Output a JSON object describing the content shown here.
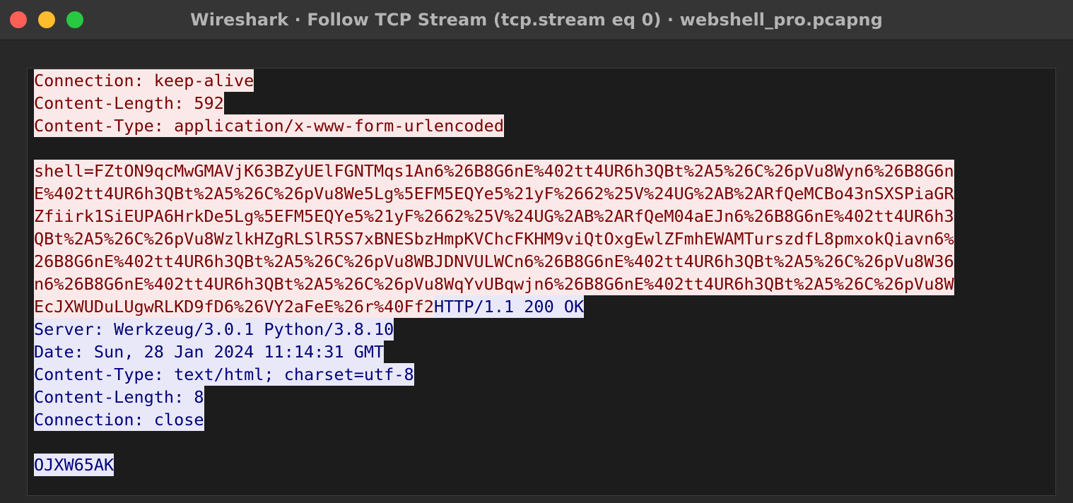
{
  "window": {
    "title": "Wireshark · Follow TCP Stream (tcp.stream eq 0) · webshell_pro.pcapng"
  },
  "colors": {
    "client_bg": "#fbe9e9",
    "client_fg": "#7a0000",
    "server_bg": "#e8e8f8",
    "server_fg": "#00007a"
  },
  "stream": {
    "lines": [
      {
        "segments": [
          {
            "dir": "client",
            "text": "Connection: keep-alive"
          }
        ]
      },
      {
        "segments": [
          {
            "dir": "client",
            "text": "Content-Length: 592"
          }
        ]
      },
      {
        "segments": [
          {
            "dir": "client",
            "text": "Content-Type: application/x-www-form-urlencoded"
          }
        ]
      },
      {
        "segments": []
      },
      {
        "segments": [
          {
            "dir": "client",
            "text": "shell=FZtON9qcMwGMAVjK63BZyUElFGNTMqs1An6%26B8G6nE%402tt4UR6h3QBt%2A5%26C%26pVu8Wyn6%26B8G6n"
          }
        ]
      },
      {
        "segments": [
          {
            "dir": "client",
            "text": "E%402tt4UR6h3QBt%2A5%26C%26pVu8We5Lg%5EFM5EQYe5%21yF%2662%25V%24UG%2AB%2ARfQeMCBo43nSXSPiaGR"
          }
        ]
      },
      {
        "segments": [
          {
            "dir": "client",
            "text": "Zfiirk1SiEUPA6HrkDe5Lg%5EFM5EQYe5%21yF%2662%25V%24UG%2AB%2ARfQeM04aEJn6%26B8G6nE%402tt4UR6h3"
          }
        ]
      },
      {
        "segments": [
          {
            "dir": "client",
            "text": "QBt%2A5%26C%26pVu8WzlkHZgRLSlR5S7xBNESbzHmpKVChcFKHM9viQtOxgEwlZFmhEWAMTurszdfL8pmxokQiavn6%"
          }
        ]
      },
      {
        "segments": [
          {
            "dir": "client",
            "text": "26B8G6nE%402tt4UR6h3QBt%2A5%26C%26pVu8WBJDNVULWCn6%26B8G6nE%402tt4UR6h3QBt%2A5%26C%26pVu8W36"
          }
        ]
      },
      {
        "segments": [
          {
            "dir": "client",
            "text": "n6%26B8G6nE%402tt4UR6h3QBt%2A5%26C%26pVu8WqYvUBqwjn6%26B8G6nE%402tt4UR6h3QBt%2A5%26C%26pVu8W"
          }
        ]
      },
      {
        "segments": [
          {
            "dir": "client",
            "text": "EcJXWUDuLUgwRLKD9fD6%26VY2aFeE%26r%40Ff2"
          },
          {
            "dir": "client",
            "text": "HTTP/1.1 200 OK"
          }
        ]
      },
      {
        "segments": [
          {
            "dir": "server",
            "text": "Server: Werkzeug/3.0.1 Python/3.8.10"
          }
        ]
      },
      {
        "segments": [
          {
            "dir": "server",
            "text": "Date: Sun, 28 Jan 2024 11:14:31 GMT"
          }
        ]
      },
      {
        "segments": [
          {
            "dir": "server",
            "text": "Content-Type: text/html; charset=utf-8"
          }
        ]
      },
      {
        "segments": [
          {
            "dir": "server",
            "text": "Content-Length: 8"
          }
        ]
      },
      {
        "segments": [
          {
            "dir": "server",
            "text": "Connection: close"
          }
        ]
      },
      {
        "segments": []
      },
      {
        "segments": [
          {
            "dir": "server",
            "text": "OJXW65AK"
          }
        ]
      }
    ]
  }
}
